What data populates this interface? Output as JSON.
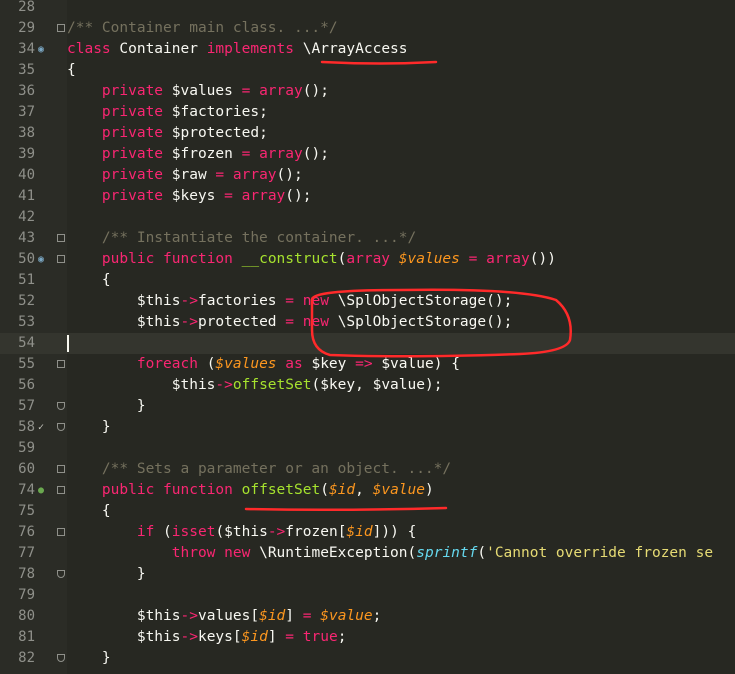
{
  "editor": {
    "lines": [
      {
        "no": "28",
        "code": ""
      },
      {
        "no": "29",
        "code": "/** Container main class. ...*/"
      },
      {
        "no": "34",
        "code": "class Container implements \\ArrayAccess"
      },
      {
        "no": "35",
        "code": "{"
      },
      {
        "no": "36",
        "code": "    private $values = array();"
      },
      {
        "no": "37",
        "code": "    private $factories;"
      },
      {
        "no": "38",
        "code": "    private $protected;"
      },
      {
        "no": "39",
        "code": "    private $frozen = array();"
      },
      {
        "no": "40",
        "code": "    private $raw = array();"
      },
      {
        "no": "41",
        "code": "    private $keys = array();"
      },
      {
        "no": "42",
        "code": ""
      },
      {
        "no": "43",
        "code": "    /** Instantiate the container. ...*/"
      },
      {
        "no": "50",
        "code": "    public function __construct(array $values = array())"
      },
      {
        "no": "51",
        "code": "    {"
      },
      {
        "no": "52",
        "code": "        $this->factories = new \\SplObjectStorage();"
      },
      {
        "no": "53",
        "code": "        $this->protected = new \\SplObjectStorage();"
      },
      {
        "no": "54",
        "code": ""
      },
      {
        "no": "55",
        "code": "        foreach ($values as $key => $value) {"
      },
      {
        "no": "56",
        "code": "            $this->offsetSet($key, $value);"
      },
      {
        "no": "57",
        "code": "        }"
      },
      {
        "no": "58",
        "code": "    }"
      },
      {
        "no": "59",
        "code": ""
      },
      {
        "no": "60",
        "code": "    /** Sets a parameter or an object. ...*/"
      },
      {
        "no": "74",
        "code": "    public function offsetSet($id, $value)"
      },
      {
        "no": "75",
        "code": "    {"
      },
      {
        "no": "76",
        "code": "        if (isset($this->frozen[$id])) {"
      },
      {
        "no": "77",
        "code": "            throw new \\RuntimeException(sprintf('Cannot override frozen se"
      },
      {
        "no": "78",
        "code": "        }"
      },
      {
        "no": "79",
        "code": ""
      },
      {
        "no": "80",
        "code": "        $this->values[$id] = $value;"
      },
      {
        "no": "81",
        "code": "        $this->keys[$id] = true;"
      },
      {
        "no": "82",
        "code": "    }"
      }
    ]
  },
  "gutter_icons": {
    "34": "implementation-icon",
    "50": "override-icon",
    "58": "check-icon",
    "74": "implements-method-icon"
  },
  "colors": {
    "background": "#272822",
    "keyword": "#f92672",
    "function": "#a6e22e",
    "string": "#e6db74",
    "literal": "#ae81ff",
    "param": "#fd971f",
    "comment": "#75715e",
    "annotation": "#ff2a2a"
  }
}
